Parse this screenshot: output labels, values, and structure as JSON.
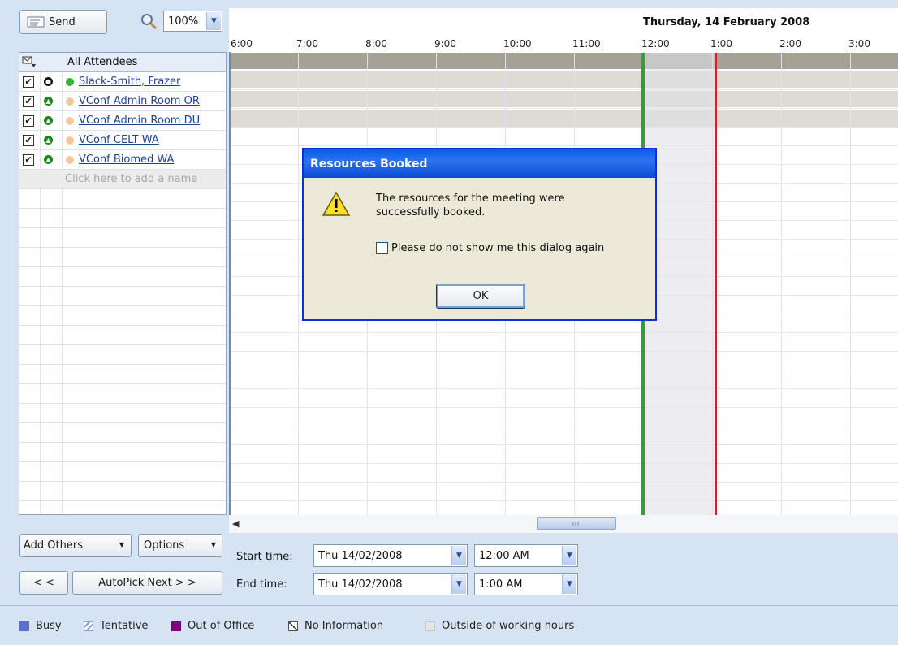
{
  "toolbar": {
    "send_label": "Send",
    "zoom_value": "100%"
  },
  "schedule": {
    "date_header": "Thursday, 14 February 2008",
    "hours": [
      "6:00",
      "7:00",
      "8:00",
      "9:00",
      "10:00",
      "11:00",
      "12:00",
      "1:00",
      "2:00",
      "3:00"
    ]
  },
  "attendees": {
    "header": "All Attendees",
    "items": [
      {
        "name": "Slack-Smith, Frazer",
        "checked": true,
        "status_color": "#2fb52f"
      },
      {
        "name": "VConf Admin Room OR",
        "checked": true,
        "status_color": "#f4c79a"
      },
      {
        "name": "VConf Admin Room DU",
        "checked": true,
        "status_color": "#f4c79a"
      },
      {
        "name": "VConf CELT WA",
        "checked": true,
        "status_color": "#f4c79a"
      },
      {
        "name": "VConf Biomed WA",
        "checked": true,
        "status_color": "#f4c79a"
      }
    ],
    "add_placeholder": "Click here to add a name"
  },
  "dialog": {
    "title": "Resources Booked",
    "message": "The resources for the meeting were successfully booked.",
    "checkbox_label": "Please do not show me this dialog again",
    "ok_label": "OK",
    "icon": "warning-icon"
  },
  "controls": {
    "add_others_label": "Add Others",
    "options_label": "Options",
    "prev_label": "< <",
    "autopick_label": "AutoPick Next > >",
    "start_time_label": "Start time:",
    "end_time_label": "End time:",
    "start_date": "Thu 14/02/2008",
    "start_time": "12:00 AM",
    "end_date": "Thu 14/02/2008",
    "end_time": "1:00 AM"
  },
  "legend": {
    "busy": "Busy",
    "tentative": "Tentative",
    "out_of_office": "Out of Office",
    "no_information": "No Information",
    "outside_hours": "Outside of working hours",
    "busy_color": "#5a6fd6",
    "oof_color": "#800080"
  }
}
